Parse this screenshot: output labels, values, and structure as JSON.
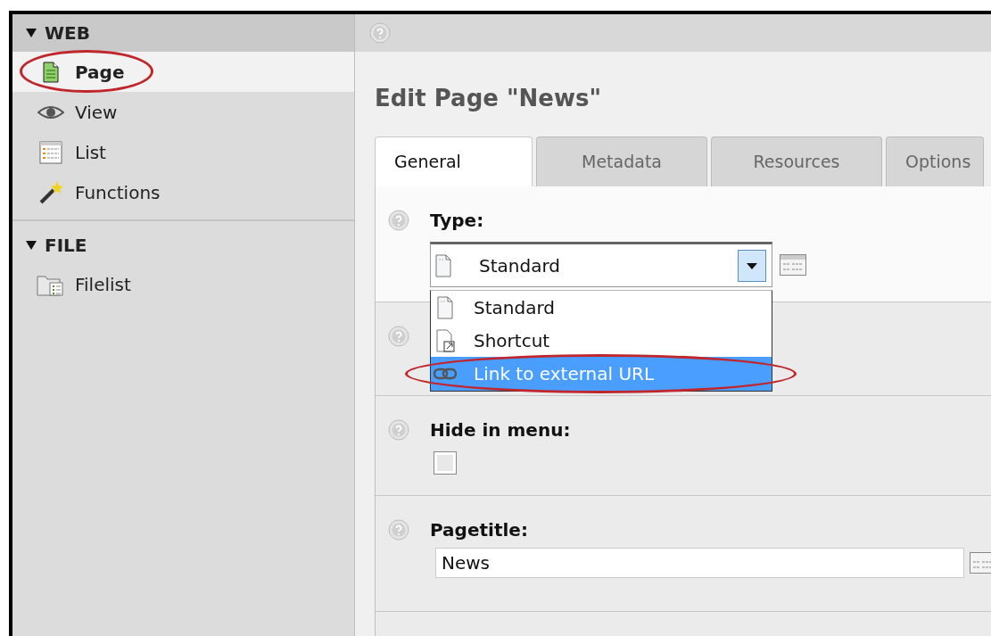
{
  "sidebar": {
    "groups": [
      {
        "title": "WEB",
        "expanded": true,
        "items": [
          {
            "label": "Page",
            "kind": "page",
            "selected": true,
            "annotated": true
          },
          {
            "label": "View",
            "kind": "view",
            "selected": false,
            "annotated": false
          },
          {
            "label": "List",
            "kind": "list",
            "selected": false,
            "annotated": false
          },
          {
            "label": "Functions",
            "kind": "functions",
            "selected": false,
            "annotated": false
          }
        ]
      },
      {
        "title": "FILE",
        "expanded": true,
        "items": [
          {
            "label": "Filelist",
            "kind": "filelist",
            "selected": false,
            "annotated": false
          }
        ]
      }
    ]
  },
  "heading": "Edit Page \"News\"",
  "tabs": [
    {
      "label": "General",
      "selected": true
    },
    {
      "label": "Metadata",
      "selected": false
    },
    {
      "label": "Resources",
      "selected": false
    },
    {
      "label": "Options",
      "selected": false
    }
  ],
  "form": {
    "fields": [
      {
        "kind": "select",
        "label": "Type:",
        "value": "Standard",
        "expanded": true,
        "options": [
          {
            "label": "Standard",
            "kind": "page",
            "highlighted": false,
            "annotated": false
          },
          {
            "label": "Shortcut",
            "kind": "shortcut",
            "highlighted": false,
            "annotated": false
          },
          {
            "label": "Link to external URL",
            "kind": "link",
            "highlighted": true,
            "annotated": true
          }
        ]
      },
      {
        "kind": "blank"
      },
      {
        "kind": "checkbox",
        "label": "Hide in menu:",
        "checked": false
      },
      {
        "kind": "text",
        "label": "Pagetitle:",
        "value": "News"
      },
      {
        "kind": "partial"
      }
    ]
  }
}
